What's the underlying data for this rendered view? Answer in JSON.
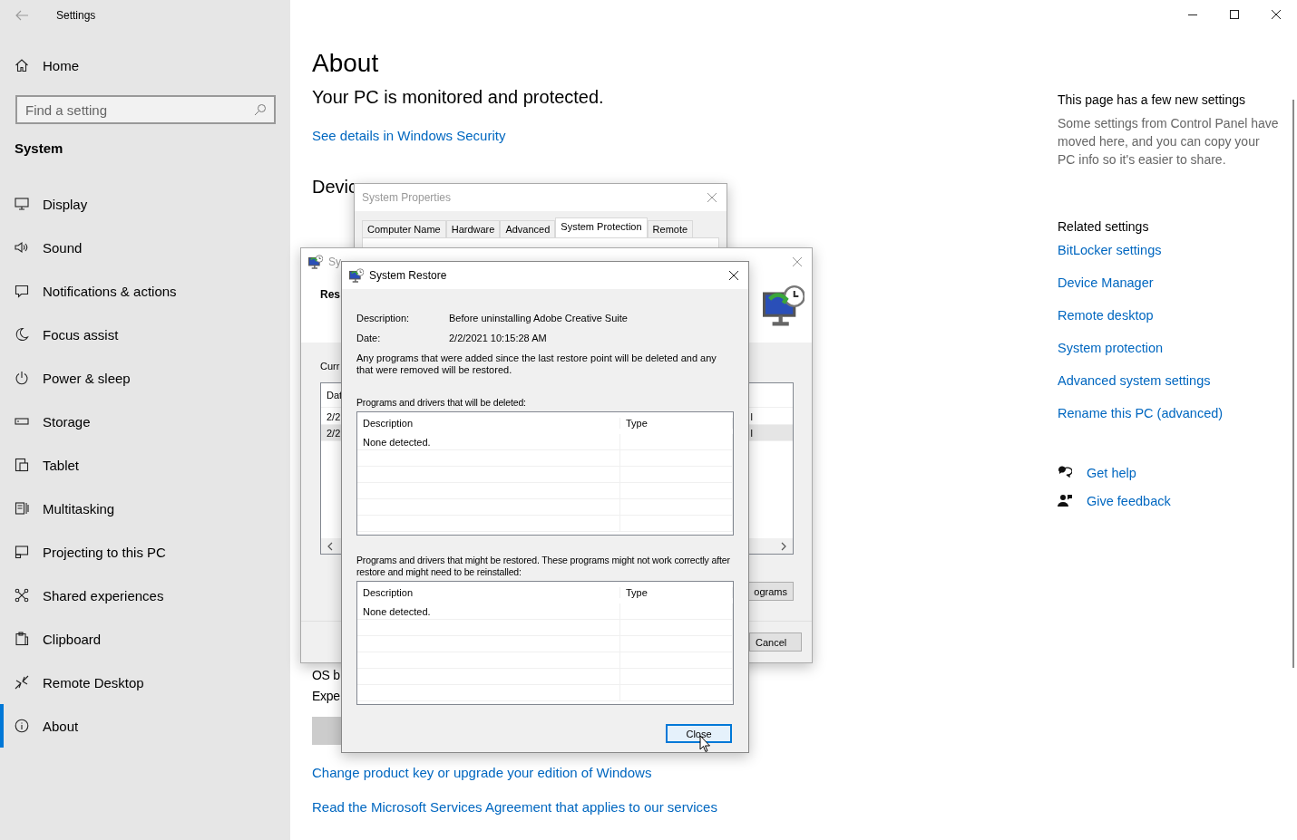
{
  "window": {
    "title": "Settings"
  },
  "sidebar": {
    "home": "Home",
    "search": {
      "placeholder": "Find a setting"
    },
    "section": "System",
    "items": [
      {
        "label": "Display",
        "kind": "display",
        "selected": false
      },
      {
        "label": "Sound",
        "kind": "sound",
        "selected": false
      },
      {
        "label": "Notifications & actions",
        "kind": "notifications",
        "selected": false
      },
      {
        "label": "Focus assist",
        "kind": "focus",
        "selected": false
      },
      {
        "label": "Power & sleep",
        "kind": "power",
        "selected": false
      },
      {
        "label": "Storage",
        "kind": "storage",
        "selected": false
      },
      {
        "label": "Tablet",
        "kind": "tablet",
        "selected": false
      },
      {
        "label": "Multitasking",
        "kind": "multitasking",
        "selected": false
      },
      {
        "label": "Projecting to this PC",
        "kind": "projecting",
        "selected": false
      },
      {
        "label": "Shared experiences",
        "kind": "shared",
        "selected": false
      },
      {
        "label": "Clipboard",
        "kind": "clipboard",
        "selected": false
      },
      {
        "label": "Remote Desktop",
        "kind": "remote",
        "selected": false
      },
      {
        "label": "About",
        "kind": "about",
        "selected": true
      }
    ]
  },
  "main": {
    "title": "About",
    "status": "Your PC is monitored and protected.",
    "status_link": "See details in Windows Security",
    "heading": "Devic",
    "specs": [
      "OS b",
      "Expe"
    ],
    "links": [
      "Change product key or upgrade your edition of Windows",
      "Read the Microsoft Services Agreement that applies to our services"
    ]
  },
  "aside": {
    "notice_title": "This page has a few new settings",
    "notice": "Some settings from Control Panel have moved here, and you can copy your PC info so it's easier to share.",
    "related_title": "Related settings",
    "related": [
      "BitLocker settings",
      "Device Manager",
      "Remote desktop",
      "System protection",
      "Advanced system settings",
      "Rename this PC (advanced)"
    ],
    "help": [
      {
        "label": "Get help",
        "kind": "help"
      },
      {
        "label": "Give feedback",
        "kind": "feedback"
      }
    ]
  },
  "system_properties": {
    "title": "System Properties",
    "tabs": [
      {
        "label": "Computer Name",
        "selected": false
      },
      {
        "label": "Hardware",
        "selected": false
      },
      {
        "label": "Advanced",
        "selected": false
      },
      {
        "label": "System Protection",
        "selected": true
      },
      {
        "label": "Remote",
        "selected": false
      }
    ]
  },
  "restore_wizard": {
    "title": "Sy",
    "heading": "Res",
    "label": "Curr",
    "list": {
      "header": "Dat",
      "rows": [
        {
          "cells": [
            "2/2",
            "l"
          ],
          "selected": false
        },
        {
          "cells": [
            "2/2",
            "l"
          ],
          "selected": true
        }
      ]
    },
    "button": "ograms",
    "cancel": "Cancel"
  },
  "restore_dialog": {
    "title": "System Restore",
    "fields": [
      {
        "label": "Description:",
        "value": "Before uninstalling Adobe Creative Suite"
      },
      {
        "label": "Date:",
        "value": "2/2/2021 10:15:28 AM"
      }
    ],
    "note": "Any programs that were added since the last restore point will be deleted and any that were removed will be restored.",
    "tables": [
      {
        "caption": "Programs and drivers that will be deleted:",
        "columns": [
          "Description",
          "Type"
        ],
        "rows": [
          [
            "None detected."
          ]
        ]
      },
      {
        "caption": "Programs and drivers that might be restored. These programs might not work correctly after restore and might need to be reinstalled:",
        "columns": [
          "Description",
          "Type"
        ],
        "rows": [
          [
            "None detected."
          ]
        ]
      }
    ],
    "button": "Close"
  }
}
